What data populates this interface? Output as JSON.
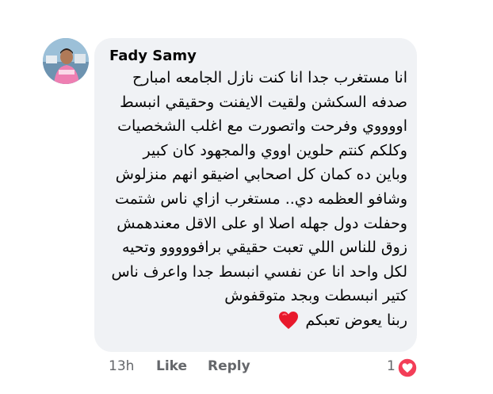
{
  "comment": {
    "author": "Fady Samy",
    "lines": [
      "انا مستغرب جدا انا كنت نازل الجامعه امبارح",
      "صدفه السكشن ولقيت الايفنت وحقيقي انبسط",
      "اووووي وفرحت واتصورت مع اغلب الشخصيات",
      "وكلكم كنتم حلوين اووي والمجهود كان كبير",
      "وباين ده كمان كل اصحابي اضيقو انهم منزلوش",
      "وشافو العظمه دي..  مستغرب ازاي ناس شتمت",
      "وحفلت دول جهله اصلا او على الاقل معندهمش",
      "زوق للناس اللي تعبت حقيقي برافووووو وتحيه",
      "لكل واحد انا عن نفسي انبسط جدا واعرف ناس",
      "كتير انبسطت وبجد متوقفوش"
    ],
    "last_line": "ربنا يعوض تعبكم",
    "emoji_icon": "red-heart-emoji"
  },
  "actions": {
    "time": "13h",
    "like": "Like",
    "reply": "Reply"
  },
  "reactions": {
    "count": "1",
    "icon": "love-reaction-icon"
  },
  "colors": {
    "bubble": "#f0f2f5",
    "text": "#050505",
    "meta": "#65676b",
    "heart": "#f33e58"
  }
}
